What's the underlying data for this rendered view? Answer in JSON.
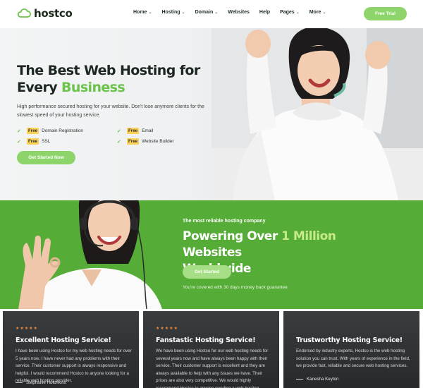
{
  "brand": {
    "name": "hostco",
    "accent": "#6cc24a",
    "button_green": "#8dd56b",
    "band_green": "#55ad37",
    "star_color": "#ef8a3a",
    "highlight_yellow": "#fbd35a"
  },
  "nav": {
    "items": [
      {
        "label": "Home",
        "dropdown": true
      },
      {
        "label": "Hosting",
        "dropdown": true
      },
      {
        "label": "Domain",
        "dropdown": true
      },
      {
        "label": "Websites",
        "dropdown": false
      },
      {
        "label": "Help",
        "dropdown": false
      },
      {
        "label": "Pages",
        "dropdown": true
      },
      {
        "label": "More",
        "dropdown": true
      }
    ],
    "cta": "Free Trial"
  },
  "hero": {
    "title_line1": "The Best Web Hosting for",
    "title_line2_plain": "Every",
    "title_line2_accent": "Business",
    "subtitle": "High performance secured hosting for your website. Don't lose anymore clients for the slowest speed of your hosting service.",
    "features": [
      {
        "tag": "Free",
        "label": "Domain Registration"
      },
      {
        "tag": "Free",
        "label": "Email"
      },
      {
        "tag": "Free",
        "label": "SSL"
      },
      {
        "tag": "Free",
        "label": "Website Builder"
      }
    ],
    "cta": "Get Started Now"
  },
  "band": {
    "kicker": "The most reliable hosting company",
    "title_a": "Powering Over",
    "title_hl": "1 Million",
    "title_b": "Websites",
    "title_c": "Worldwide",
    "cta": "Get Started",
    "note": "You're covered with 30 days money back guarantee"
  },
  "testimonials": [
    {
      "stars": "★★★★★",
      "title": "Excellent Hosting Service!",
      "body": "I have been using Hostco for my web hosting needs for over 5 years now. I have never had any problems with their service. Their customer support is always responsive and helpful. I would recommend Hostco to anyone looking for a reliable web hosting provider.",
      "author": "Stephanie Hutchkins"
    },
    {
      "stars": "★★★★★",
      "title": "Fanstastic Hosting Service!",
      "body": "We have been using Hostco for our web hosting needs for several years now and have always been happy with their service. Their customer support is excellent and they are always available to help with any issues we have. Their prices are also very competitive. We would highly recommend Hostco to anyone needing a web hosting",
      "author": ""
    },
    {
      "stars": "",
      "title": "Trustworthy Hosting Service!",
      "body": "Endorsed by industry experts, Hostco is the web hosting solution you can trust. With years of experience in the field, we provide fast, reliable and secure web hosting services.",
      "author": "Kanesha Keyton"
    }
  ]
}
